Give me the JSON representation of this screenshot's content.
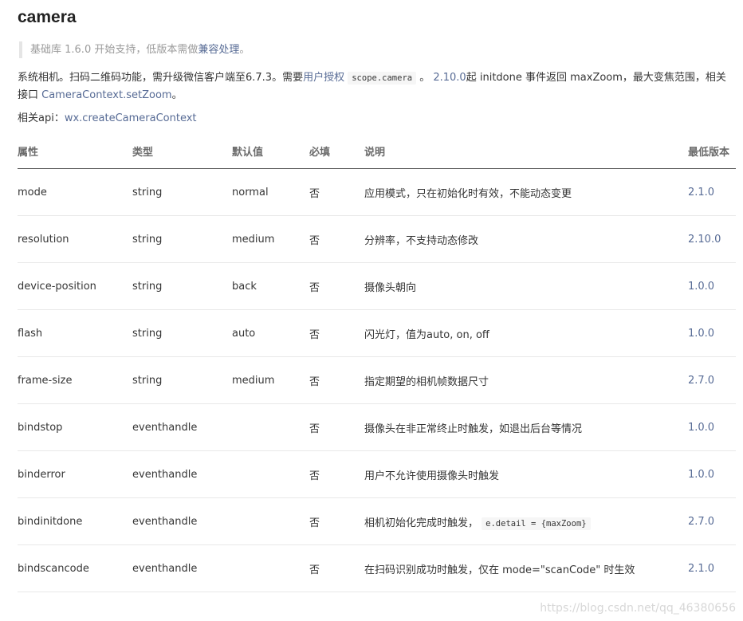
{
  "title": "camera",
  "note": {
    "prefix": "基础库 1.6.0 开始支持，低版本需做",
    "link": "兼容处理",
    "suffix": "。"
  },
  "description": {
    "part1": "系统相机。扫码二维码功能，需升级微信客户端至6.7.3。需要",
    "auth_link": "用户授权",
    "scope_code": "scope.camera",
    "part2": " 。 ",
    "version_link": "2.10.0",
    "part3": "起 initdone 事件返回 maxZoom，最大变焦范围，相关接口 ",
    "api_link": "CameraContext.setZoom",
    "part4": "。"
  },
  "api": {
    "label": "相关api：",
    "link": "wx.createCameraContext"
  },
  "table": {
    "headers": [
      "属性",
      "类型",
      "默认值",
      "必填",
      "说明",
      "最低版本"
    ],
    "rows": [
      {
        "name": "mode",
        "type": "string",
        "default": "normal",
        "required": "否",
        "desc": "应用模式，只在初始化时有效，不能动态变更",
        "code": "",
        "version": "2.1.0"
      },
      {
        "name": "resolution",
        "type": "string",
        "default": "medium",
        "required": "否",
        "desc": "分辨率，不支持动态修改",
        "code": "",
        "version": "2.10.0"
      },
      {
        "name": "device-position",
        "type": "string",
        "default": "back",
        "required": "否",
        "desc": "摄像头朝向",
        "code": "",
        "version": "1.0.0"
      },
      {
        "name": "flash",
        "type": "string",
        "default": "auto",
        "required": "否",
        "desc": "闪光灯，值为auto, on, off",
        "code": "",
        "version": "1.0.0"
      },
      {
        "name": "frame-size",
        "type": "string",
        "default": "medium",
        "required": "否",
        "desc": "指定期望的相机帧数据尺寸",
        "code": "",
        "version": "2.7.0"
      },
      {
        "name": "bindstop",
        "type": "eventhandle",
        "default": "",
        "required": "否",
        "desc": "摄像头在非正常终止时触发，如退出后台等情况",
        "code": "",
        "version": "1.0.0"
      },
      {
        "name": "binderror",
        "type": "eventhandle",
        "default": "",
        "required": "否",
        "desc": "用户不允许使用摄像头时触发",
        "code": "",
        "version": "1.0.0"
      },
      {
        "name": "bindinitdone",
        "type": "eventhandle",
        "default": "",
        "required": "否",
        "desc": "相机初始化完成时触发，",
        "code": "e.detail = {maxZoom}",
        "version": "2.7.0"
      },
      {
        "name": "bindscancode",
        "type": "eventhandle",
        "default": "",
        "required": "否",
        "desc": "在扫码识别成功时触发，仅在 mode=\"scanCode\" 时生效",
        "code": "",
        "version": "2.1.0"
      }
    ]
  },
  "watermark": "https://blog.csdn.net/qq_46380656"
}
